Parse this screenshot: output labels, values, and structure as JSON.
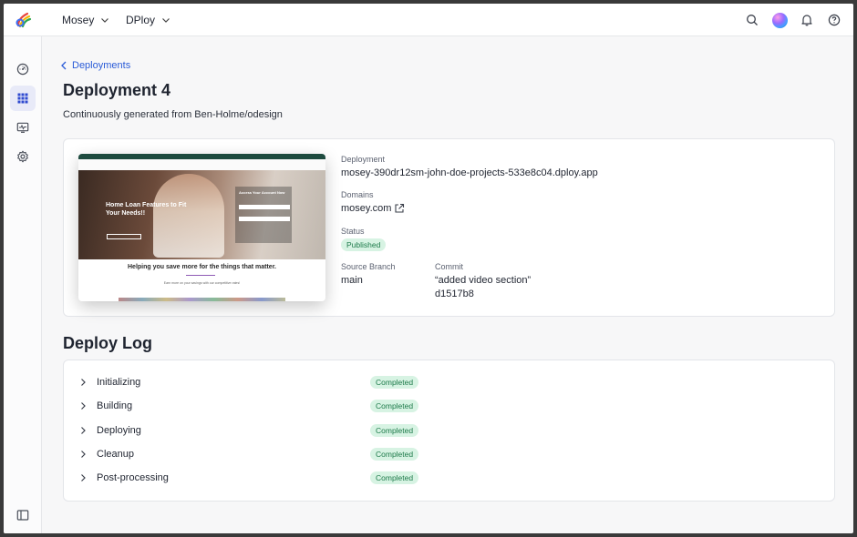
{
  "topbar": {
    "org_menu": "Mosey",
    "project_menu": "DPloy",
    "icons": [
      "search-icon",
      "avatar",
      "bell-icon",
      "help-icon"
    ]
  },
  "sidebar": {
    "items": [
      {
        "name": "dashboard-icon",
        "active": false
      },
      {
        "name": "apps-grid-icon",
        "active": true
      },
      {
        "name": "monitor-icon",
        "active": false
      },
      {
        "name": "settings-icon",
        "active": false
      }
    ],
    "bottom": "panel-toggle-icon"
  },
  "breadcrumb": {
    "label": "Deployments"
  },
  "page": {
    "title": "Deployment 4",
    "subtitle": "Continuously generated from Ben-Holme/odesign"
  },
  "details": {
    "deployment_label": "Deployment",
    "deployment_value": "mosey-390dr12sm-john-doe-projects-533e8c04.dploy.app",
    "domains_label": "Domains",
    "domains_value": "mosey.com",
    "status_label": "Status",
    "status_value": "Published",
    "branch_label": "Source Branch",
    "branch_value": "main",
    "commit_label": "Commit",
    "commit_message": "“added video section”",
    "commit_hash": "d1517b8"
  },
  "preview": {
    "hero_heading": "Home Loan Features to Fit Your Needs!!",
    "form_title": "Access Your Account Now",
    "tagline": "Helping you save more for the things that matter.",
    "small_text": "Earn more on your savings with our competitive rates!"
  },
  "deploy_log": {
    "title": "Deploy Log",
    "steps": [
      {
        "name": "Initializing",
        "status": "Completed"
      },
      {
        "name": "Building",
        "status": "Completed"
      },
      {
        "name": "Deploying",
        "status": "Completed"
      },
      {
        "name": "Cleanup",
        "status": "Completed"
      },
      {
        "name": "Post-processing",
        "status": "Completed"
      }
    ]
  },
  "colors": {
    "accent": "#2a5bd7",
    "status_green_text": "#1d7a4a",
    "status_green_bg": "#d7f3e3"
  }
}
